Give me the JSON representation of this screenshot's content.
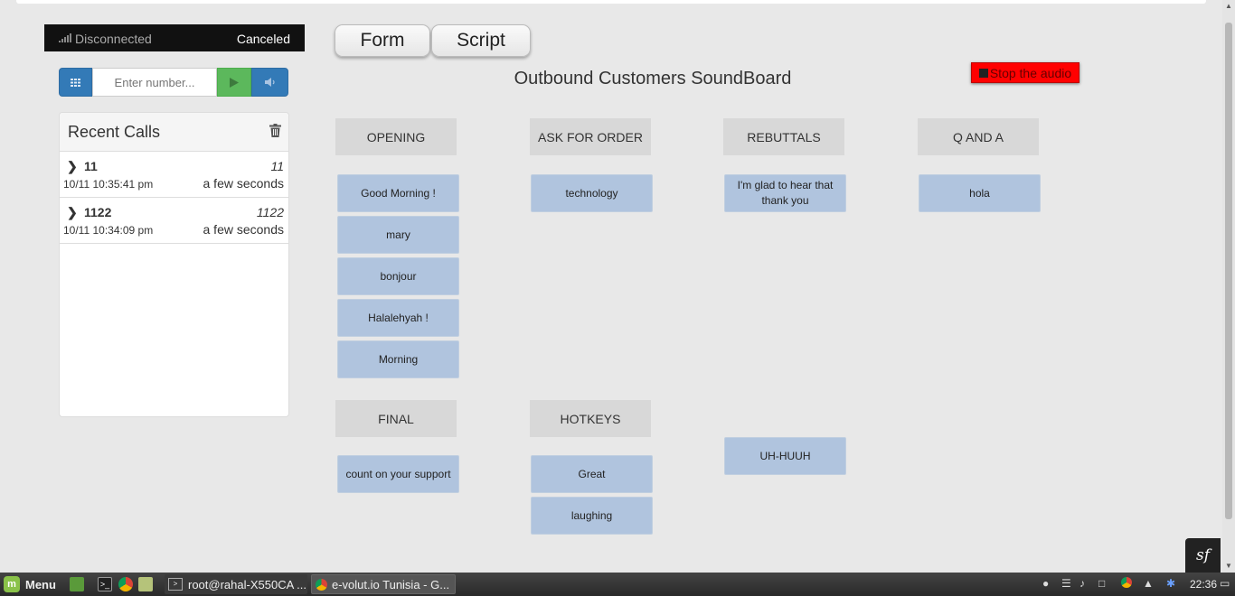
{
  "status": {
    "connection": "Disconnected",
    "call_state": "Canceled"
  },
  "dialer": {
    "placeholder": "Enter number..."
  },
  "recent_calls": {
    "title": "Recent Calls",
    "items": [
      {
        "number": "11",
        "number_italic": "11",
        "date": "10/11 10:35:41 pm",
        "ago": "a few seconds"
      },
      {
        "number": "1122",
        "number_italic": "1122",
        "date": "10/11 10:34:09 pm",
        "ago": "a few seconds"
      }
    ]
  },
  "tabs": {
    "form": "Form",
    "script": "Script"
  },
  "board": {
    "title": "Outbound Customers SoundBoard",
    "stop_label": "Stop the audio",
    "stop_color": "#ff0000",
    "clip_color": "#b0c4de",
    "categories": {
      "opening": "OPENING",
      "ask": "ASK FOR ORDER",
      "rebuttals": "REBUTTALS",
      "qa": "Q AND A",
      "final": "FINAL",
      "hotkeys": "HOTKEYS"
    },
    "clips": {
      "opening": [
        "Good Morning !",
        "mary",
        "bonjour",
        "Halalehyah !",
        "Morning"
      ],
      "ask": [
        "technology"
      ],
      "rebuttals": [
        "I'm glad to hear that thank you"
      ],
      "qa": [
        "hola"
      ],
      "final": [
        "count on your support"
      ],
      "hotkeys": [
        "Great",
        "laughing"
      ],
      "extra": [
        "UH-HUUH"
      ]
    }
  },
  "taskbar": {
    "menu": "Menu",
    "task1": "root@rahal-X550CA ...",
    "task2": "e-volut.io Tunisia - G...",
    "clock": "22:36"
  }
}
